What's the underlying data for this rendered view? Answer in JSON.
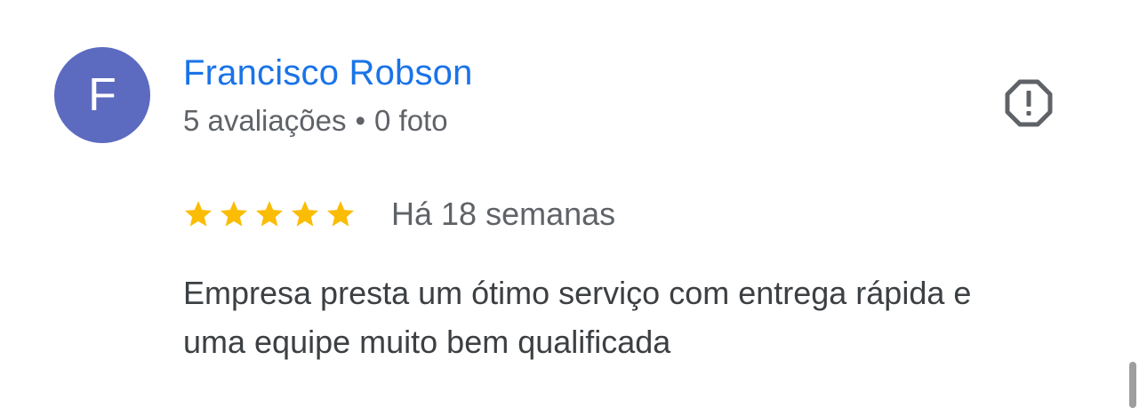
{
  "reviewer": {
    "initial": "F",
    "name": "Francisco Robson",
    "reviews_count_label": "5 avaliações",
    "separator": "•",
    "photos_label": "0 foto",
    "avatar_color": "#5c6bc0"
  },
  "review": {
    "rating": 5,
    "rating_max": 5,
    "time_ago": "Há 18 semanas",
    "text": "Empresa presta um ótimo serviço com entrega rápida e uma equipe muito bem qualificada"
  },
  "colors": {
    "name": "#1a73e8",
    "star": "#fbbc04",
    "meta": "#5f6368",
    "body": "#3c4043"
  },
  "actions": {
    "report_icon": "report-icon"
  }
}
